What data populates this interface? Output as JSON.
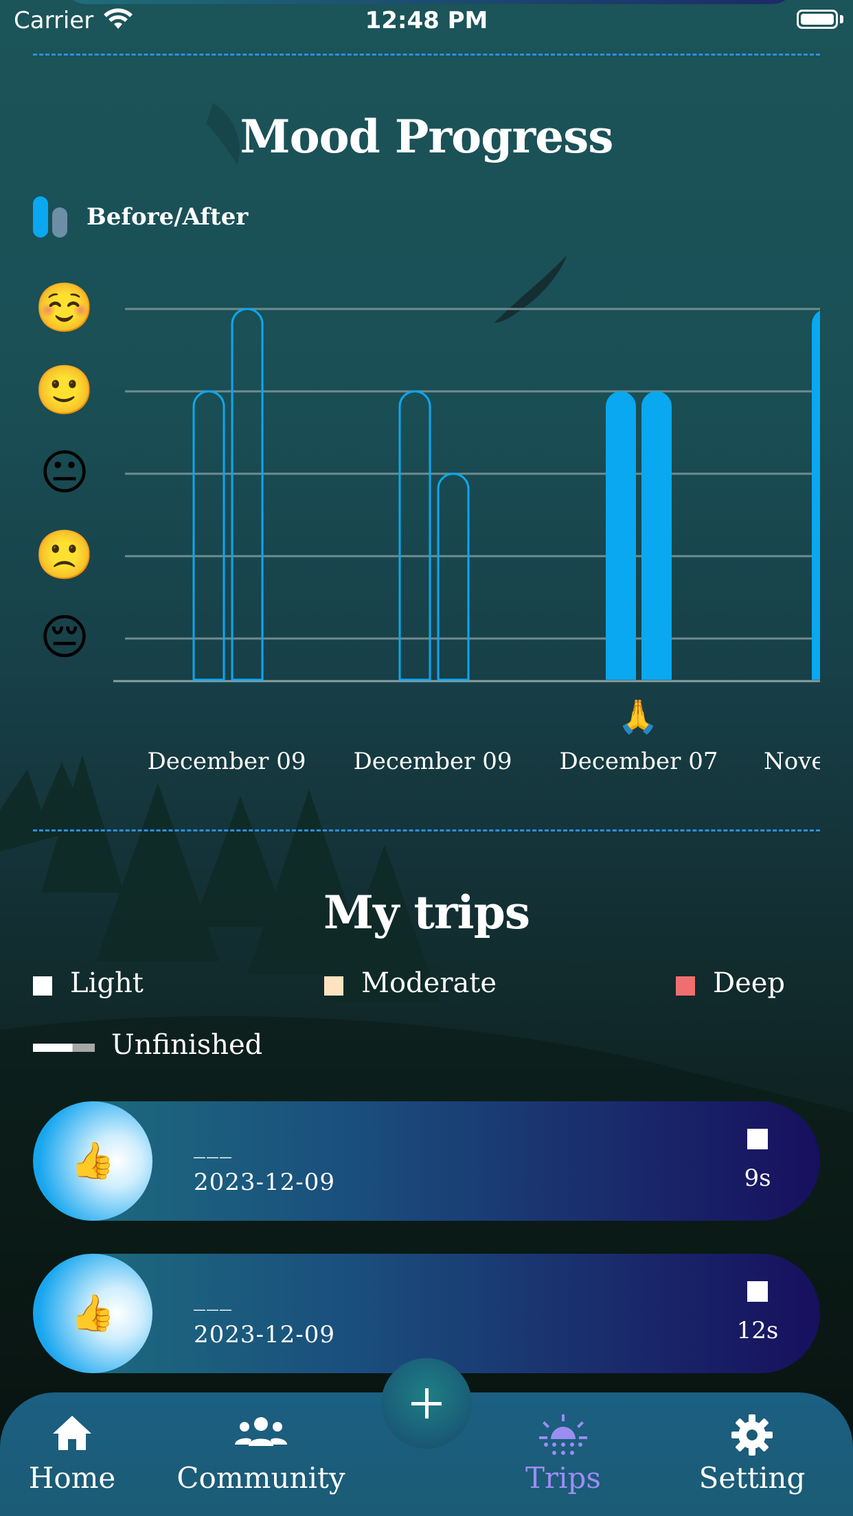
{
  "status_bar": {
    "carrier": "Carrier",
    "time": "12:48 PM"
  },
  "mood_section": {
    "title": "Mood Progress",
    "legend_label": "Before/After"
  },
  "chart_data": {
    "type": "bar",
    "y_levels": [
      "😔",
      "🙁",
      "😐",
      "🙂",
      "☺️"
    ],
    "categories": [
      "December 09",
      "December 09",
      "December 07",
      "Nove"
    ],
    "category_markers": [
      "",
      "",
      "🙏",
      ""
    ],
    "series": [
      {
        "values": [
          4,
          4,
          4,
          5
        ]
      },
      {
        "values": [
          5,
          3,
          4,
          null
        ]
      }
    ],
    "fill_styles": [
      "outline",
      "outline",
      "filled",
      "filled"
    ],
    "ylim": [
      0,
      5
    ],
    "grid": true,
    "accent_color": "#0aa8f0"
  },
  "trips_section": {
    "title": "My trips",
    "legend": [
      {
        "label": "Light",
        "color": "#ffffff"
      },
      {
        "label": "Moderate",
        "color": "#fde3c0"
      },
      {
        "label": "Deep",
        "color": "#ef6f6f"
      }
    ],
    "unfinished_label": "Unfinished",
    "trips": [
      {
        "icon": "👍",
        "name": "___",
        "date": "2023-12-09",
        "duration": "9s"
      },
      {
        "icon": "👍",
        "name": "___",
        "date": "2023-12-09",
        "duration": "12s"
      }
    ]
  },
  "tab_bar": {
    "tabs": [
      {
        "label": "Home",
        "icon": "home-icon",
        "active": false
      },
      {
        "label": "Community",
        "icon": "community-icon",
        "active": false
      },
      {
        "label": "Trips",
        "icon": "sunrise-icon",
        "active": true
      },
      {
        "label": "Setting",
        "icon": "gear-icon",
        "active": false
      }
    ],
    "active_color": "#9c8df3",
    "add_icon": "plus-icon"
  }
}
